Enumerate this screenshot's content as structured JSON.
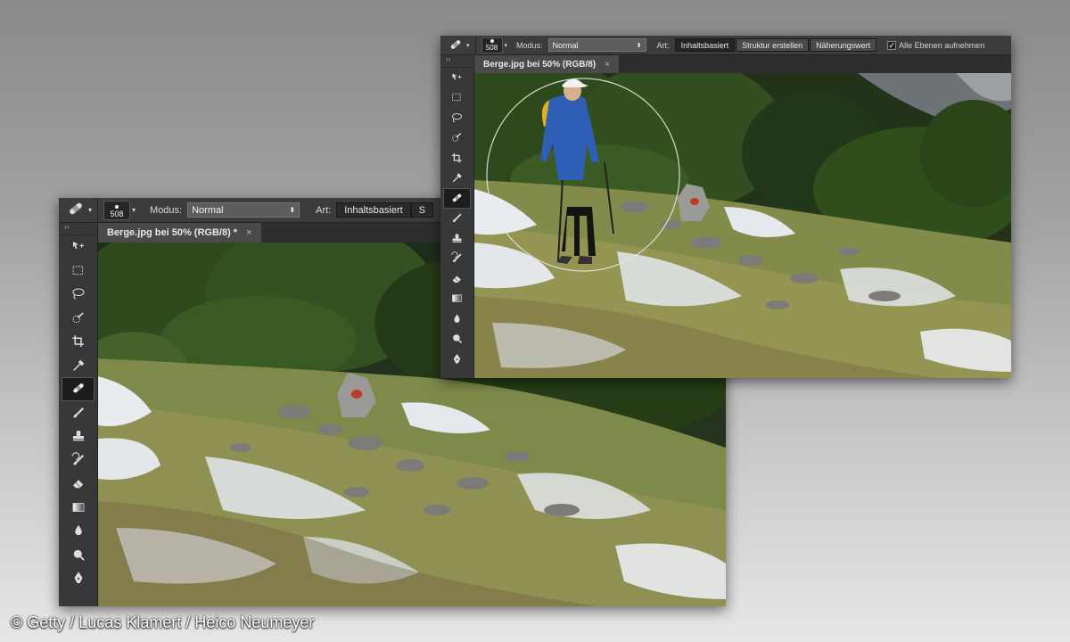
{
  "window_back": {
    "brush_size": "508",
    "mode_label": "Modus:",
    "mode_value": "Normal",
    "type_label": "Art:",
    "type_option_1": "Inhaltsbasiert",
    "type_option_2_partial": "S",
    "tab_title": "Berge.jpg bei 50% (RGB/8) *",
    "tab_close": "×"
  },
  "window_front": {
    "brush_size": "508",
    "mode_label": "Modus:",
    "mode_value": "Normal",
    "type_label": "Art:",
    "type_options": [
      "Inhaltsbasiert",
      "Struktur erstellen",
      "Näherungswert"
    ],
    "sample_all_label": "Alle Ebenen aufnehmen",
    "sample_all_checked": true,
    "tab_title": "Berge.jpg bei 50% (RGB/8)",
    "tab_close": "×"
  },
  "tools": [
    "move-tool",
    "marquee-tool",
    "lasso-tool",
    "quick-selection-tool",
    "crop-tool",
    "eyedropper-tool",
    "spot-healing-brush-tool",
    "brush-tool",
    "clone-stamp-tool",
    "history-brush-tool",
    "eraser-tool",
    "gradient-tool",
    "blur-tool",
    "dodge-tool",
    "pen-tool"
  ],
  "selected_tool": "spot-healing-brush-tool",
  "credit": "© Getty / Lucas Klamert / Heico Neumeyer",
  "colors": {
    "ui_dark": "#2b2b2b",
    "ui_panel": "#3c3c3c",
    "tab_active": "#4a4a4a",
    "jacket_blue": "#2f5fb5",
    "backpack_yellow": "#e0b020",
    "pine_green": "#2f4a1e",
    "snow": "#e9ecef"
  }
}
